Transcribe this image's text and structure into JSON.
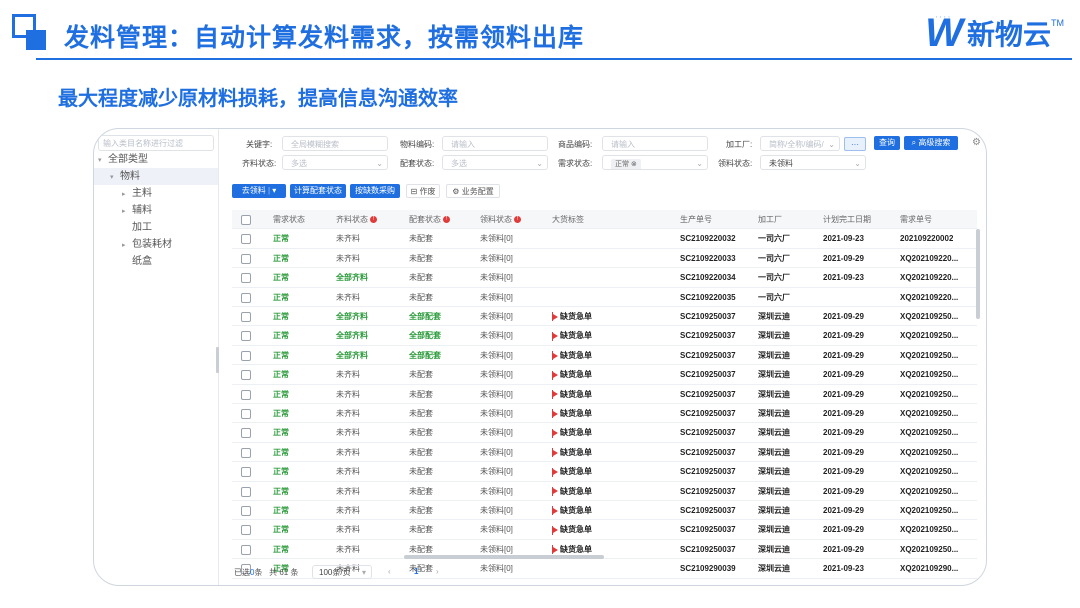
{
  "slide": {
    "title": "发料管理：自动计算发料需求，按需领料出库",
    "subtitle": "最大程度减少原材料损耗，提高信息沟通效率",
    "brand_name": "新物云",
    "brand_tm": "TM",
    "brand_color": "#1f6fe0"
  },
  "sidebar": {
    "search_placeholder": "输入类目名称进行过滤",
    "tree": [
      {
        "label": "全部类型",
        "arrow": "▾",
        "indent": 0,
        "selected": false
      },
      {
        "label": "物料",
        "arrow": "▾",
        "indent": 1,
        "selected": true
      },
      {
        "label": "主料",
        "arrow": "▸",
        "indent": 2,
        "selected": false
      },
      {
        "label": "辅料",
        "arrow": "▸",
        "indent": 2,
        "selected": false
      },
      {
        "label": "加工",
        "arrow": "",
        "indent": 2,
        "selected": false
      },
      {
        "label": "包装耗材",
        "arrow": "▸",
        "indent": 2,
        "selected": false
      },
      {
        "label": "纸盒",
        "arrow": "",
        "indent": 2,
        "selected": false
      }
    ]
  },
  "filters": {
    "keyword_label": "关键字:",
    "keyword_placeholder": "全局模糊搜索",
    "material_code_label": "物料编码:",
    "material_code_placeholder": "请输入",
    "product_code_label": "商品编码:",
    "product_code_placeholder": "请输入",
    "factory_label": "加工厂:",
    "factory_placeholder": "简称/全称/编码/",
    "query_button": "查询",
    "advanced_button": "高级搜索",
    "more_button": "···",
    "complete_status_label": "齐料状态:",
    "complete_status_placeholder": "多选",
    "match_status_label": "配套状态:",
    "match_status_placeholder": "多选",
    "demand_status_label": "需求状态:",
    "demand_status_tag": "正常",
    "demand_status_tag_close": "⊗",
    "pick_status_label": "领料状态:",
    "pick_status_value": "未领料"
  },
  "toolbar": {
    "go_pick": "去领料",
    "go_pick_dropdown": "▾",
    "calc_match": "计算配套状态",
    "purchase_by_shortage": "按缺数采购",
    "void": "作废",
    "void_icon": "⊟",
    "business_config": "业务配置",
    "config_icon": "⚙"
  },
  "table": {
    "columns": [
      "需求状态",
      "齐料状态",
      "配套状态",
      "领料状态",
      "大货标签",
      "生产单号",
      "加工厂",
      "计划完工日期",
      "需求单号"
    ],
    "column_info_marks": [
      "",
      "!",
      "!",
      "!",
      "",
      "",
      "",
      "",
      ""
    ],
    "rows": [
      {
        "demand": "正常",
        "complete": "未齐料",
        "match": "未配套",
        "pick": "未领料[0]",
        "tag": "",
        "order": "SC2109220032",
        "factory": "一司六厂",
        "date": "2021-09-23",
        "req": "202109220002"
      },
      {
        "demand": "正常",
        "complete": "未齐料",
        "match": "未配套",
        "pick": "未领料[0]",
        "tag": "",
        "order": "SC2109220033",
        "factory": "一司六厂",
        "date": "2021-09-29",
        "req": "XQ202109220..."
      },
      {
        "demand": "正常",
        "complete": "全部齐料",
        "match": "未配套",
        "pick": "未领料[0]",
        "tag": "",
        "order": "SC2109220034",
        "factory": "一司六厂",
        "date": "2021-09-23",
        "req": "XQ202109220..."
      },
      {
        "demand": "正常",
        "complete": "未齐料",
        "match": "未配套",
        "pick": "未领料[0]",
        "tag": "",
        "order": "SC2109220035",
        "factory": "一司六厂",
        "date": "",
        "req": "XQ202109220..."
      },
      {
        "demand": "正常",
        "complete": "全部齐料",
        "match": "全部配套",
        "pick": "未领料[0]",
        "tag": "缺货急单",
        "order": "SC2109250037",
        "factory": "深圳云迪",
        "date": "2021-09-29",
        "req": "XQ202109250..."
      },
      {
        "demand": "正常",
        "complete": "全部齐料",
        "match": "全部配套",
        "pick": "未领料[0]",
        "tag": "缺货急单",
        "order": "SC2109250037",
        "factory": "深圳云迪",
        "date": "2021-09-29",
        "req": "XQ202109250..."
      },
      {
        "demand": "正常",
        "complete": "全部齐料",
        "match": "全部配套",
        "pick": "未领料[0]",
        "tag": "缺货急单",
        "order": "SC2109250037",
        "factory": "深圳云迪",
        "date": "2021-09-29",
        "req": "XQ202109250..."
      },
      {
        "demand": "正常",
        "complete": "未齐料",
        "match": "未配套",
        "pick": "未领料[0]",
        "tag": "缺货急单",
        "order": "SC2109250037",
        "factory": "深圳云迪",
        "date": "2021-09-29",
        "req": "XQ202109250..."
      },
      {
        "demand": "正常",
        "complete": "未齐料",
        "match": "未配套",
        "pick": "未领料[0]",
        "tag": "缺货急单",
        "order": "SC2109250037",
        "factory": "深圳云迪",
        "date": "2021-09-29",
        "req": "XQ202109250..."
      },
      {
        "demand": "正常",
        "complete": "未齐料",
        "match": "未配套",
        "pick": "未领料[0]",
        "tag": "缺货急单",
        "order": "SC2109250037",
        "factory": "深圳云迪",
        "date": "2021-09-29",
        "req": "XQ202109250..."
      },
      {
        "demand": "正常",
        "complete": "未齐料",
        "match": "未配套",
        "pick": "未领料[0]",
        "tag": "缺货急单",
        "order": "SC2109250037",
        "factory": "深圳云迪",
        "date": "2021-09-29",
        "req": "XQ202109250..."
      },
      {
        "demand": "正常",
        "complete": "未齐料",
        "match": "未配套",
        "pick": "未领料[0]",
        "tag": "缺货急单",
        "order": "SC2109250037",
        "factory": "深圳云迪",
        "date": "2021-09-29",
        "req": "XQ202109250..."
      },
      {
        "demand": "正常",
        "complete": "未齐料",
        "match": "未配套",
        "pick": "未领料[0]",
        "tag": "缺货急单",
        "order": "SC2109250037",
        "factory": "深圳云迪",
        "date": "2021-09-29",
        "req": "XQ202109250..."
      },
      {
        "demand": "正常",
        "complete": "未齐料",
        "match": "未配套",
        "pick": "未领料[0]",
        "tag": "缺货急单",
        "order": "SC2109250037",
        "factory": "深圳云迪",
        "date": "2021-09-29",
        "req": "XQ202109250..."
      },
      {
        "demand": "正常",
        "complete": "未齐料",
        "match": "未配套",
        "pick": "未领料[0]",
        "tag": "缺货急单",
        "order": "SC2109250037",
        "factory": "深圳云迪",
        "date": "2021-09-29",
        "req": "XQ202109250..."
      },
      {
        "demand": "正常",
        "complete": "未齐料",
        "match": "未配套",
        "pick": "未领料[0]",
        "tag": "缺货急单",
        "order": "SC2109250037",
        "factory": "深圳云迪",
        "date": "2021-09-29",
        "req": "XQ202109250..."
      },
      {
        "demand": "正常",
        "complete": "未齐料",
        "match": "未配套",
        "pick": "未领料[0]",
        "tag": "缺货急单",
        "order": "SC2109250037",
        "factory": "深圳云迪",
        "date": "2021-09-29",
        "req": "XQ202109250..."
      },
      {
        "demand": "正常",
        "complete": "未齐料",
        "match": "未配套",
        "pick": "未领料[0]",
        "tag": "",
        "order": "SC2109290039",
        "factory": "深圳云迪",
        "date": "2021-09-23",
        "req": "XQ202109290..."
      }
    ]
  },
  "footer": {
    "selected_prefix": "已选",
    "selected_count": "0",
    "selected_suffix": "条",
    "total": "共 61 条",
    "page_size": "100条/页",
    "page_size_chev": "▾",
    "prev": "‹",
    "next": "›",
    "current_page": "1"
  }
}
